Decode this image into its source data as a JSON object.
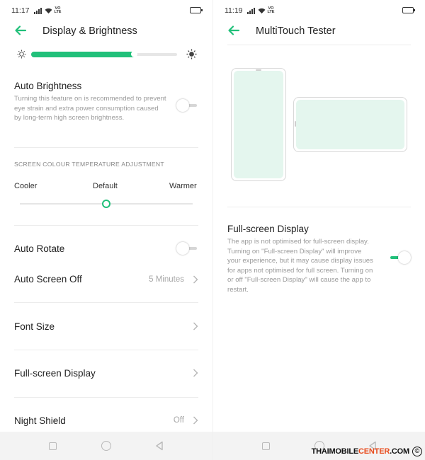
{
  "left_screen": {
    "status": {
      "time": "11:17",
      "network": "VoLTE"
    },
    "header": {
      "title": "Display & Brightness"
    },
    "brightness": {
      "level": 0.72
    },
    "auto_brightness": {
      "title": "Auto Brightness",
      "description": "Turning this feature on is recommended to prevent eye strain and extra power consumption caused by long-term high screen brightness.",
      "enabled": false
    },
    "colour_temp": {
      "section_title": "SCREEN COLOUR TEMPERATURE ADJUSTMENT",
      "cooler": "Cooler",
      "default": "Default",
      "warmer": "Warmer",
      "level": 0.5
    },
    "auto_rotate": {
      "label": "Auto Rotate",
      "enabled": false
    },
    "auto_screen_off": {
      "label": "Auto Screen Off",
      "value": "5 Minutes"
    },
    "font_size": {
      "label": "Font Size"
    },
    "full_screen": {
      "label": "Full-screen Display"
    },
    "night_shield": {
      "label": "Night Shield",
      "value": "Off"
    }
  },
  "right_screen": {
    "status": {
      "time": "11:19",
      "network": "VoLTE"
    },
    "header": {
      "title": "MultiTouch Tester"
    },
    "full_screen": {
      "title": "Full-screen Display",
      "description": "The app is not optimised for full-screen display. Turning on \"Full-screen Display\" will improve your experience, but it may cause display issues for apps not optimised for full screen. Turning on or off \"Full-screen Display\" will cause the app to restart.",
      "enabled": true
    }
  },
  "watermark": {
    "prefix": "THAIMOBILE",
    "accent": "CENTER",
    "suffix": ".COM",
    "copyright": "©"
  },
  "colors": {
    "accent": "#21c07a",
    "watermark_accent": "#e84b1c"
  }
}
